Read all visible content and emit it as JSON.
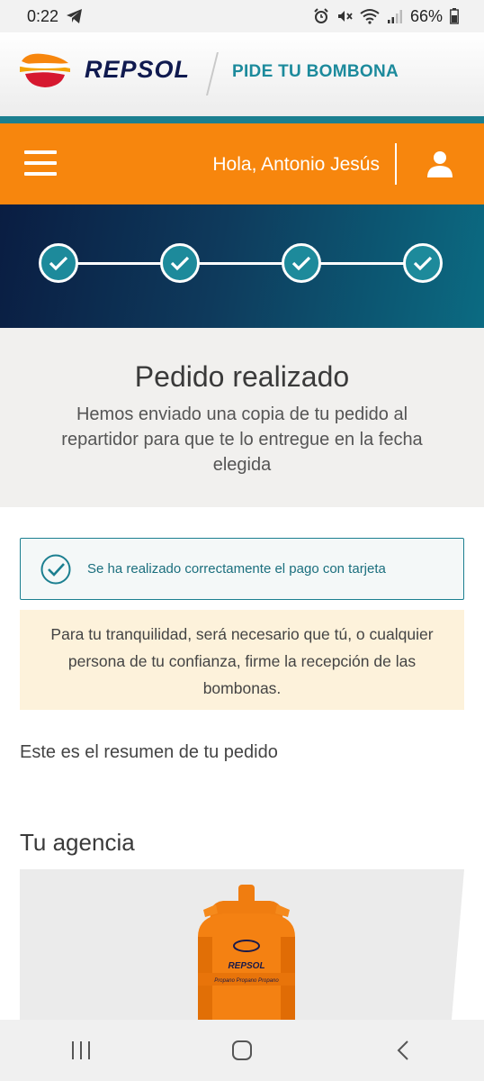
{
  "status_bar": {
    "time": "0:22",
    "battery": "66%",
    "left_icons": [
      "telegram-icon"
    ],
    "right_icons": [
      "alarm-icon",
      "mute-icon",
      "wifi-icon",
      "signal-icon",
      "battery-icon"
    ]
  },
  "header": {
    "brand": "REPSOL",
    "product": "PIDE TU BOMBONA"
  },
  "nav": {
    "greeting": "Hola, Antonio Jesús",
    "icons": [
      "menu-icon",
      "user-icon"
    ]
  },
  "stepper": {
    "steps_completed": 4,
    "steps_total": 4
  },
  "confirmation": {
    "title": "Pedido realizado",
    "subtitle": "Hemos enviado una copia de tu pedido al repartidor para que te lo entregue en la fecha elegida"
  },
  "payment_notice": "Se ha realizado correctamente el pago con tarjeta",
  "warning_notice": "Para tu tranquilidad, será necesario que tú, o cualquier persona de tu confianza, firme la recepción de las bombonas.",
  "summary_text": "Este es el resumen de tu pedido",
  "agency": {
    "heading": "Tu agencia",
    "bottle_logo": "REPSOL",
    "bottle_band": "Propano Propano Propano"
  },
  "colors": {
    "orange": "#f7860d",
    "teal": "#1b7f90",
    "navy": "#101a4f",
    "warning_bg": "#fdf2db"
  },
  "system_nav": [
    "recents-icon",
    "home-icon",
    "back-icon"
  ]
}
